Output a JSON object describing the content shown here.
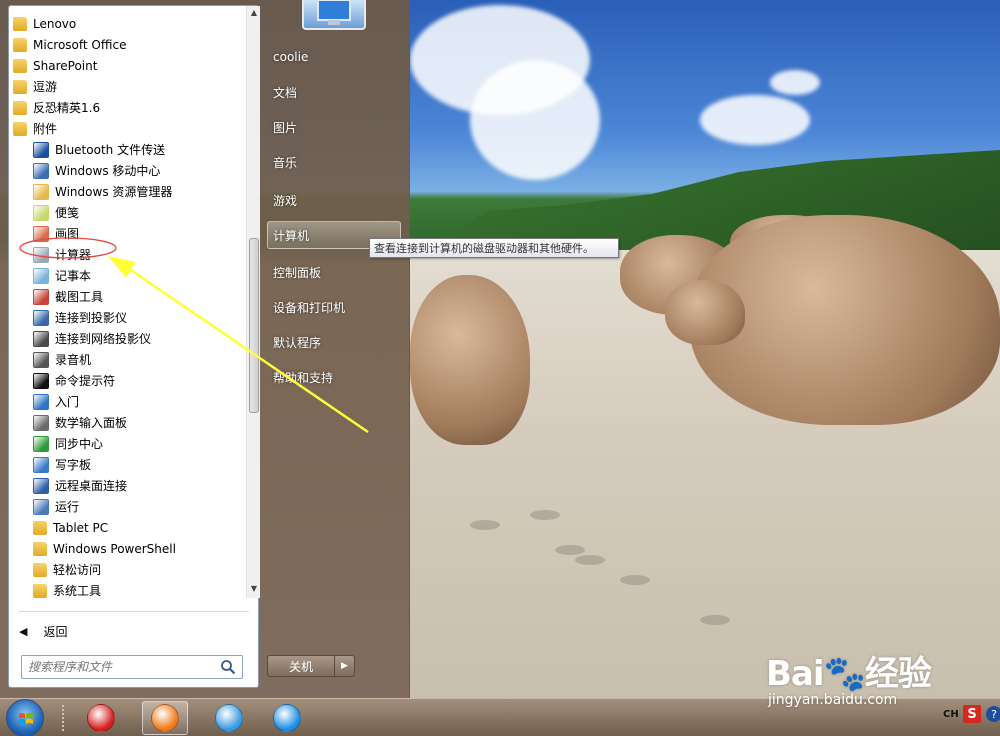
{
  "start_menu": {
    "programs": [
      {
        "label": "Lenovo",
        "type": "folder",
        "icon": "folder-icon",
        "indent": 0
      },
      {
        "label": "Microsoft Office",
        "type": "folder",
        "icon": "folder-icon",
        "indent": 0
      },
      {
        "label": "SharePoint",
        "type": "folder",
        "icon": "folder-icon",
        "indent": 0
      },
      {
        "label": "逗游",
        "type": "folder",
        "icon": "folder-icon",
        "indent": 0
      },
      {
        "label": "反恐精英1.6",
        "type": "folder",
        "icon": "folder-icon",
        "indent": 0
      },
      {
        "label": "附件",
        "type": "folder",
        "icon": "folder-open-icon",
        "indent": 0
      },
      {
        "label": "Bluetooth 文件传送",
        "type": "app",
        "icon": "bluetooth-icon",
        "indent": 1,
        "color": "#1c4fa0"
      },
      {
        "label": "Windows 移动中心",
        "type": "app",
        "icon": "mobility-center-icon",
        "indent": 1,
        "color": "#3b6db5"
      },
      {
        "label": "Windows 资源管理器",
        "type": "app",
        "icon": "explorer-icon",
        "indent": 1,
        "color": "#e6b84a"
      },
      {
        "label": "便笺",
        "type": "app",
        "icon": "sticky-notes-icon",
        "indent": 1,
        "color": "#c7d86a"
      },
      {
        "label": "画图",
        "type": "app",
        "icon": "paint-icon",
        "indent": 1,
        "color": "#d86a4a"
      },
      {
        "label": "计算器",
        "type": "app",
        "icon": "calculator-icon",
        "indent": 1,
        "color": "#9aa7b6"
      },
      {
        "label": "记事本",
        "type": "app",
        "icon": "notepad-icon",
        "indent": 1,
        "color": "#7ab3d8"
      },
      {
        "label": "截图工具",
        "type": "app",
        "icon": "snipping-tool-icon",
        "indent": 1,
        "color": "#c8443a"
      },
      {
        "label": "连接到投影仪",
        "type": "app",
        "icon": "projector-icon",
        "indent": 1,
        "color": "#3a67a8"
      },
      {
        "label": "连接到网络投影仪",
        "type": "app",
        "icon": "network-projector-icon",
        "indent": 1,
        "color": "#4a4a4a"
      },
      {
        "label": "录音机",
        "type": "app",
        "icon": "microphone-icon",
        "indent": 1,
        "color": "#555555"
      },
      {
        "label": "命令提示符",
        "type": "app",
        "icon": "command-prompt-icon",
        "indent": 1,
        "color": "#111111"
      },
      {
        "label": "入门",
        "type": "app",
        "icon": "getting-started-icon",
        "indent": 1,
        "color": "#2f73c7"
      },
      {
        "label": "数学输入面板",
        "type": "app",
        "icon": "math-input-icon",
        "indent": 1,
        "color": "#6a6a6a"
      },
      {
        "label": "同步中心",
        "type": "app",
        "icon": "sync-center-icon",
        "indent": 1,
        "color": "#2f9a3a"
      },
      {
        "label": "写字板",
        "type": "app",
        "icon": "wordpad-icon",
        "indent": 1,
        "color": "#3a7ac7"
      },
      {
        "label": "远程桌面连接",
        "type": "app",
        "icon": "remote-desktop-icon",
        "indent": 1,
        "color": "#2d5fa8"
      },
      {
        "label": "运行",
        "type": "app",
        "icon": "run-icon",
        "indent": 1,
        "color": "#4a7ab8"
      },
      {
        "label": "Tablet PC",
        "type": "folder",
        "icon": "folder-icon",
        "indent": 1
      },
      {
        "label": "Windows PowerShell",
        "type": "folder",
        "icon": "folder-icon",
        "indent": 1
      },
      {
        "label": "轻松访问",
        "type": "folder",
        "icon": "folder-icon",
        "indent": 1
      },
      {
        "label": "系统工具",
        "type": "folder",
        "icon": "folder-icon",
        "indent": 1
      }
    ],
    "back_label": "返回",
    "search_placeholder": "搜索程序和文件",
    "right_items": [
      "coolie",
      "文档",
      "图片",
      "音乐",
      "游戏",
      "计算机",
      "控制面板",
      "设备和打印机",
      "默认程序",
      "帮助和支持"
    ],
    "highlighted_right_item": "计算机",
    "shutdown_label": "关机",
    "tooltip": "查看连接到计算机的磁盘驱动器和其他硬件。"
  },
  "taskbar": {
    "apps": [
      {
        "name": "media-player-icon",
        "color": "#d62020"
      },
      {
        "name": "thunder-download-icon",
        "color": "#f07a1a",
        "active": true
      },
      {
        "name": "bird-app-icon",
        "color": "#3a9ae0"
      },
      {
        "name": "kugou-icon",
        "color": "#1f8ee6"
      }
    ],
    "tray": {
      "lang": "CH",
      "ime": "S",
      "help": "?"
    }
  },
  "watermark": {
    "logo": "Bai🐾经验",
    "url": "jingyan.baidu.com"
  },
  "colors": {
    "annotation_circle": "#e8473f",
    "annotation_arrow": "#ffff3a"
  }
}
